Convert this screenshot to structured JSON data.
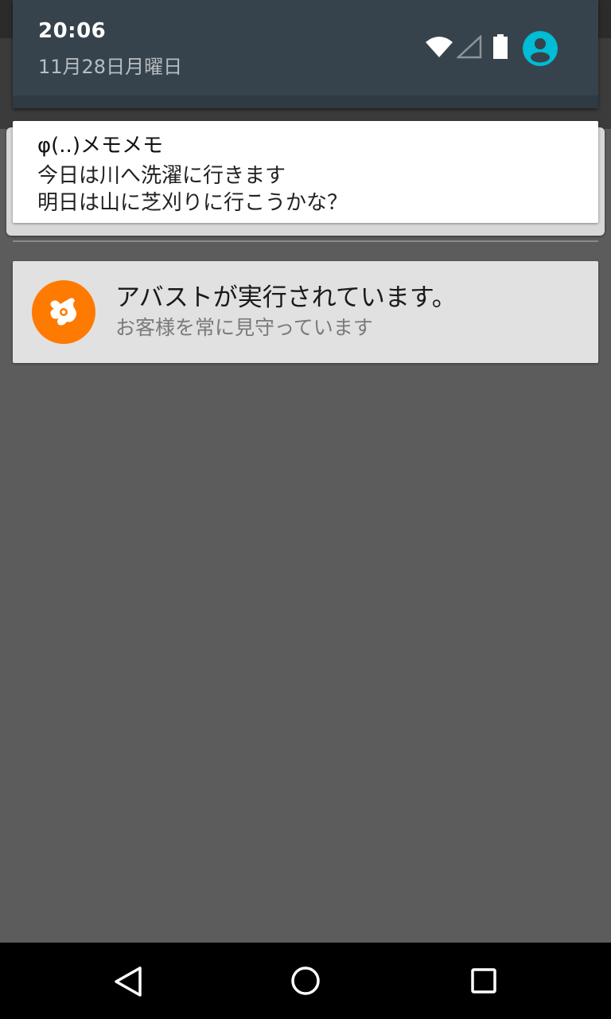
{
  "quick_settings": {
    "time": "20:06",
    "date": "11月28日月曜日",
    "icons": [
      "wifi-icon",
      "cell-signal-icon",
      "battery-icon",
      "user-avatar-icon"
    ],
    "accent_color": "#00bcd4"
  },
  "notifications": [
    {
      "app": "memo",
      "title": "φ(..)メモメモ",
      "lines": [
        "今日は川へ洗濯に行きます",
        "明日は山に芝刈りに行こうかな？"
      ]
    },
    {
      "app": "avast",
      "icon": "avast-logo-icon",
      "icon_color": "#ff7a00",
      "title": "アバストが実行されています。",
      "subtitle": "お客様を常に見守っています"
    }
  ],
  "nav_bar": {
    "buttons": [
      "back-icon",
      "home-icon",
      "recent-apps-icon"
    ]
  }
}
